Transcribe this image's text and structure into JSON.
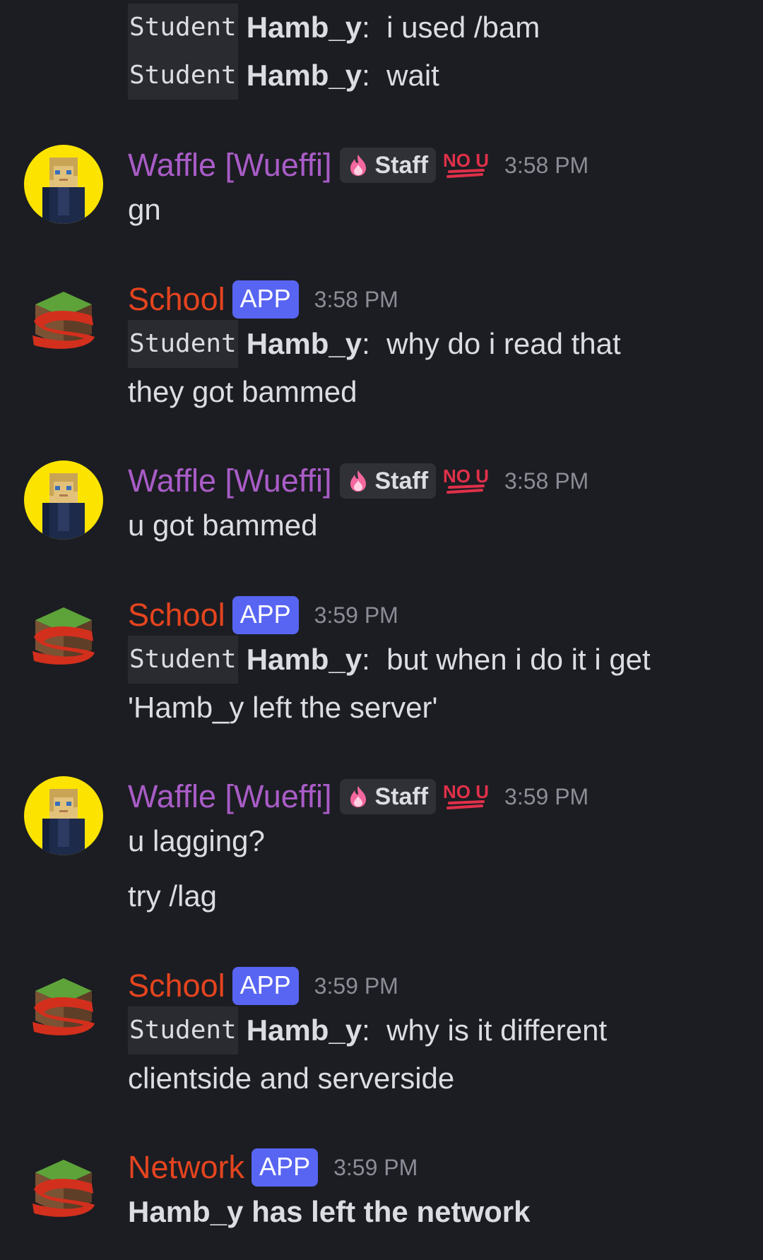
{
  "messages": [
    {
      "type": "continuation",
      "lines": [
        {
          "role": "Student",
          "name": "Hamb_y",
          "text": "i used /bam"
        },
        {
          "role": "Student",
          "name": "Hamb_y",
          "text": "wait"
        }
      ]
    },
    {
      "author": "Waffle [Wueffi]",
      "badge": "Staff",
      "emoji_badge": "NO U",
      "time": "3:58 PM",
      "lines": [
        "gn"
      ]
    },
    {
      "author": "School",
      "tag": "APP",
      "time": "3:58 PM",
      "role": "Student",
      "name": "Hamb_y",
      "text_line1": "why do i read that",
      "text_line2": "they got bammed"
    },
    {
      "author": "Waffle [Wueffi]",
      "badge": "Staff",
      "emoji_badge": "NO U",
      "time": "3:58 PM",
      "lines": [
        "u got bammed"
      ]
    },
    {
      "author": "School",
      "tag": "APP",
      "time": "3:59 PM",
      "role": "Student",
      "name": "Hamb_y",
      "text_line1": "but when i do it i get",
      "text_line2": "'Hamb_y left the server'"
    },
    {
      "author": "Waffle [Wueffi]",
      "badge": "Staff",
      "emoji_badge": "NO U",
      "time": "3:59 PM",
      "lines": [
        "u lagging?",
        "try /lag"
      ]
    },
    {
      "author": "School",
      "tag": "APP",
      "time": "3:59 PM",
      "role": "Student",
      "name": "Hamb_y",
      "text_line1": "why is it different",
      "text_line2": "clientside and serverside"
    },
    {
      "author": "Network",
      "tag": "APP",
      "time": "3:59 PM",
      "text": "Hamb_y has left the network"
    }
  ],
  "colors": {
    "background": "#1c1d22",
    "waffle_name": "#a95cc7",
    "bot_name": "#e5441f",
    "app_tag": "#5865f2",
    "timestamp": "#8b8d97",
    "nou_badge": "#e0304a"
  },
  "icons": {
    "staff_badge": "pink-flame-icon",
    "emoji_badge": "no-u-icon",
    "waffle_avatar": "blond-minecraft-skin-avatar",
    "bot_avatar": "grass-block-with-red-s-logo"
  }
}
